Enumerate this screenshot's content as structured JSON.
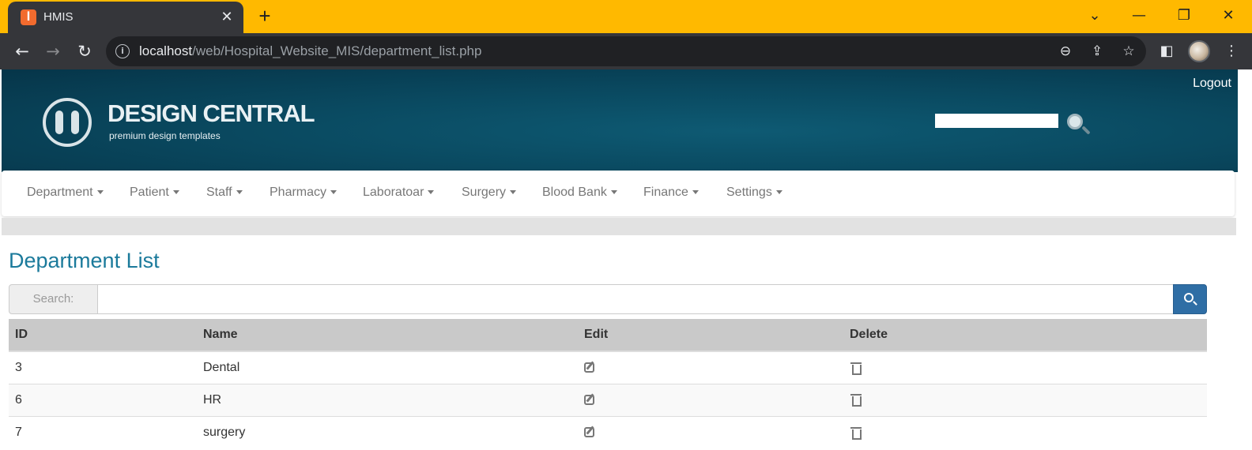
{
  "browser": {
    "tab_title": "HMIS",
    "tab_close": "✕",
    "new_tab": "+",
    "url_host": "localhost",
    "url_path": "/web/Hospital_Website_MIS/department_list.php",
    "window_controls": {
      "dropdown": "⌄",
      "minimize": "—",
      "restore": "❐",
      "close": "✕"
    }
  },
  "header": {
    "logo_title": "DESIGN CENTRAL",
    "logo_subtitle": "premium design templates",
    "logout": "Logout"
  },
  "nav": {
    "items": [
      {
        "label": "Department"
      },
      {
        "label": "Patient"
      },
      {
        "label": "Staff"
      },
      {
        "label": "Pharmacy"
      },
      {
        "label": "Laboratoar"
      },
      {
        "label": "Surgery"
      },
      {
        "label": "Blood Bank"
      },
      {
        "label": "Finance"
      },
      {
        "label": "Settings"
      }
    ]
  },
  "main": {
    "title": "Department List",
    "search": {
      "label": "Search:",
      "value": "",
      "placeholder": ""
    },
    "table": {
      "headers": [
        "ID",
        "Name",
        "Edit",
        "Delete"
      ],
      "rows": [
        {
          "id": "3",
          "name": "Dental"
        },
        {
          "id": "6",
          "name": "HR"
        },
        {
          "id": "7",
          "name": "surgery"
        }
      ]
    }
  },
  "colors": {
    "tab_strip": "#ffb900",
    "chrome_dark": "#35363a",
    "header_teal": "#0a4a61",
    "title_blue": "#1b7a9b",
    "search_button": "#2f6ea5",
    "table_header": "#c9c9c9"
  },
  "icons": [
    "xampp-favicon",
    "back-arrow-icon",
    "forward-arrow-icon",
    "reload-icon",
    "info-icon",
    "zoom-out-icon",
    "share-icon",
    "star-icon",
    "side-panel-icon",
    "profile-avatar",
    "more-vert-icon",
    "header-search-icon",
    "search-icon",
    "edit-icon",
    "trash-icon"
  ]
}
